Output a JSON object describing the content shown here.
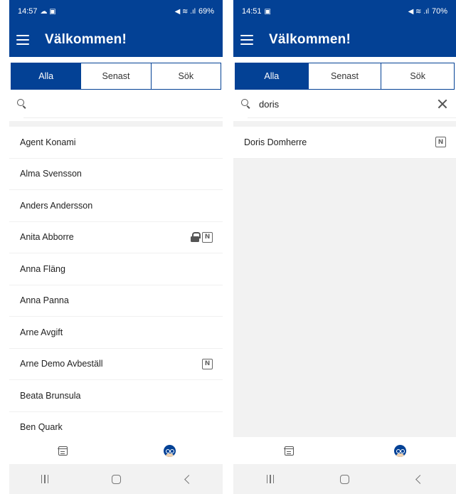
{
  "screens": [
    {
      "status": {
        "time": "14:57",
        "left_icons": "☁ ▣",
        "right_icons": "◀ ≋ .ıl",
        "battery": "69%"
      },
      "app_title": "Välkommen!",
      "tabs": [
        {
          "label": "Alla",
          "active": true
        },
        {
          "label": "Senast",
          "active": false
        },
        {
          "label": "Sök",
          "active": false
        }
      ],
      "search": {
        "value": ""
      },
      "list": [
        {
          "name": "Agent Konami",
          "lock": false,
          "nfc": false
        },
        {
          "name": "Alma Svensson",
          "lock": false,
          "nfc": false
        },
        {
          "name": "Anders Andersson",
          "lock": false,
          "nfc": false
        },
        {
          "name": "Anita Abborre",
          "lock": true,
          "nfc": true
        },
        {
          "name": "Anna Fläng",
          "lock": false,
          "nfc": false
        },
        {
          "name": "Anna Panna",
          "lock": false,
          "nfc": false
        },
        {
          "name": "Arne Avgift",
          "lock": false,
          "nfc": false
        },
        {
          "name": "Arne Demo Avbeställ",
          "lock": false,
          "nfc": true
        },
        {
          "name": "Beata Brunsula",
          "lock": false,
          "nfc": false
        },
        {
          "name": "Ben Quark",
          "lock": false,
          "nfc": false
        }
      ]
    },
    {
      "status": {
        "time": "14:51",
        "left_icons": "▣",
        "right_icons": "◀ ≋ .ıl",
        "battery": "70%"
      },
      "app_title": "Välkommen!",
      "tabs": [
        {
          "label": "Alla",
          "active": true
        },
        {
          "label": "Senast",
          "active": false
        },
        {
          "label": "Sök",
          "active": false
        }
      ],
      "search": {
        "value": "doris"
      },
      "list": [
        {
          "name": "Doris Domherre",
          "lock": false,
          "nfc": true
        }
      ]
    }
  ],
  "icons": {
    "menu": "hamburger-menu-icon",
    "search": "search-icon",
    "clear": "close-icon",
    "lock": "lock-icon",
    "nfc": "nfc-icon",
    "calendar": "calendar-icon",
    "profile": "profile-icon",
    "sys_recents": "recents-icon",
    "sys_home": "home-icon",
    "sys_back": "back-icon"
  },
  "nfc_glyph": "N",
  "colors": {
    "brand": "#034195",
    "list_bg": "#f2f2f2"
  }
}
